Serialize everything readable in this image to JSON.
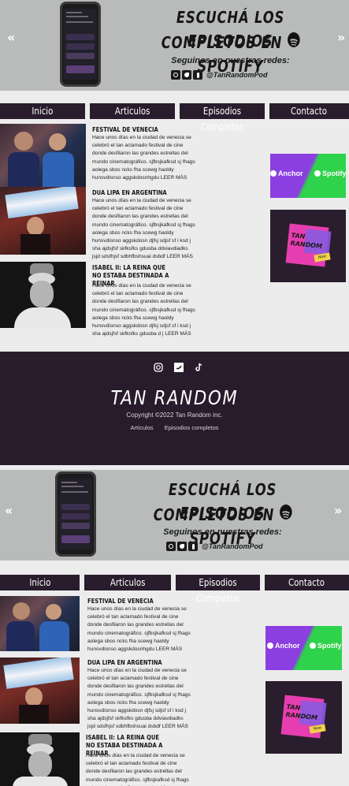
{
  "banner": {
    "headline_line1": "ESCUCHÁ LOS EPISODIOS",
    "headline_line2_pre": "COMPLETOS EN",
    "headline_line2_brand": "SPOTIFY",
    "follow_text": "Seguinos en nuestras redes:",
    "handle": "@TanRandomPod",
    "prev_arrow": "«",
    "next_arrow": "»"
  },
  "nav": {
    "items": [
      {
        "label": "Inicio"
      },
      {
        "label": "Articulos"
      },
      {
        "label": "Episodios Completos"
      },
      {
        "label": "Contacto"
      }
    ]
  },
  "articles": [
    {
      "title": "FESTIVAL DE VENECIA",
      "body": "Hace unos días en la ciudad de venecia se celebró el tan aclamado festival de cine donde desfilaron las grandes estrellas del mundo cinematográfico. sjfbsjkafksd sj fhags  aolega sbos ncks fha scewg haoldy hunsvdisnso aggskdosnhgdu LEER MÁS"
    },
    {
      "title": "DUA LIPA EN ARGENTINA",
      "body": "Hace unos días en la ciudad de venecia se celebró el tan aclamado festival de cine donde desfilaron las grandes estrellas del mundo cinematográfico. sjfbsjkafksd sj fhags  aolega sbos ncks fha scewg haoldy hunsvdisnso aggskdosn djfsj sdjsf sf i ksd j sha ajdsjfsf  skfksfks  gdusba ddviavdiadks jsjd sdsfhjsf sdbhfbshsuai dsbdf LEER MÁS"
    },
    {
      "title": "ISABEL II: LA REINA QUE NO ESTABA DESTINADA A REINAR",
      "body": "Hace unos días en la ciudad de venecia se celebró el tan aclamado festival de cine donde desfilaron las grandes estrellas del mundo cinematográfico. sjfbsjkafksd sj fhags  aolega sbos ncks fha scewg haoldy hunsvdisnso aggskdosn djfsj sdjsf sf i ksd j sha ajdsjfsf  skfksfks  gdusba d j LEER MÁS"
    }
  ],
  "sidebar": {
    "anchor_label": "Anchor",
    "spotify_label": "Spotify",
    "tan_random_line1": "TAN",
    "tan_random_line2": "RANDOM",
    "tan_random_sticker": "Now"
  },
  "footer": {
    "brand": "TAN RANDOM",
    "copyright": "Copyright ©2022 Tan Random inc.",
    "links": [
      "Artículos",
      "Episodios completos"
    ]
  },
  "colors": {
    "banner_bg": "#b9bbbb",
    "nav_bg": "#291c2c",
    "footer_bg": "#281b2b",
    "page_bg": "#ececec",
    "anchor_purple": "#8b3fe0",
    "spotify_green": "#2fd24b"
  }
}
